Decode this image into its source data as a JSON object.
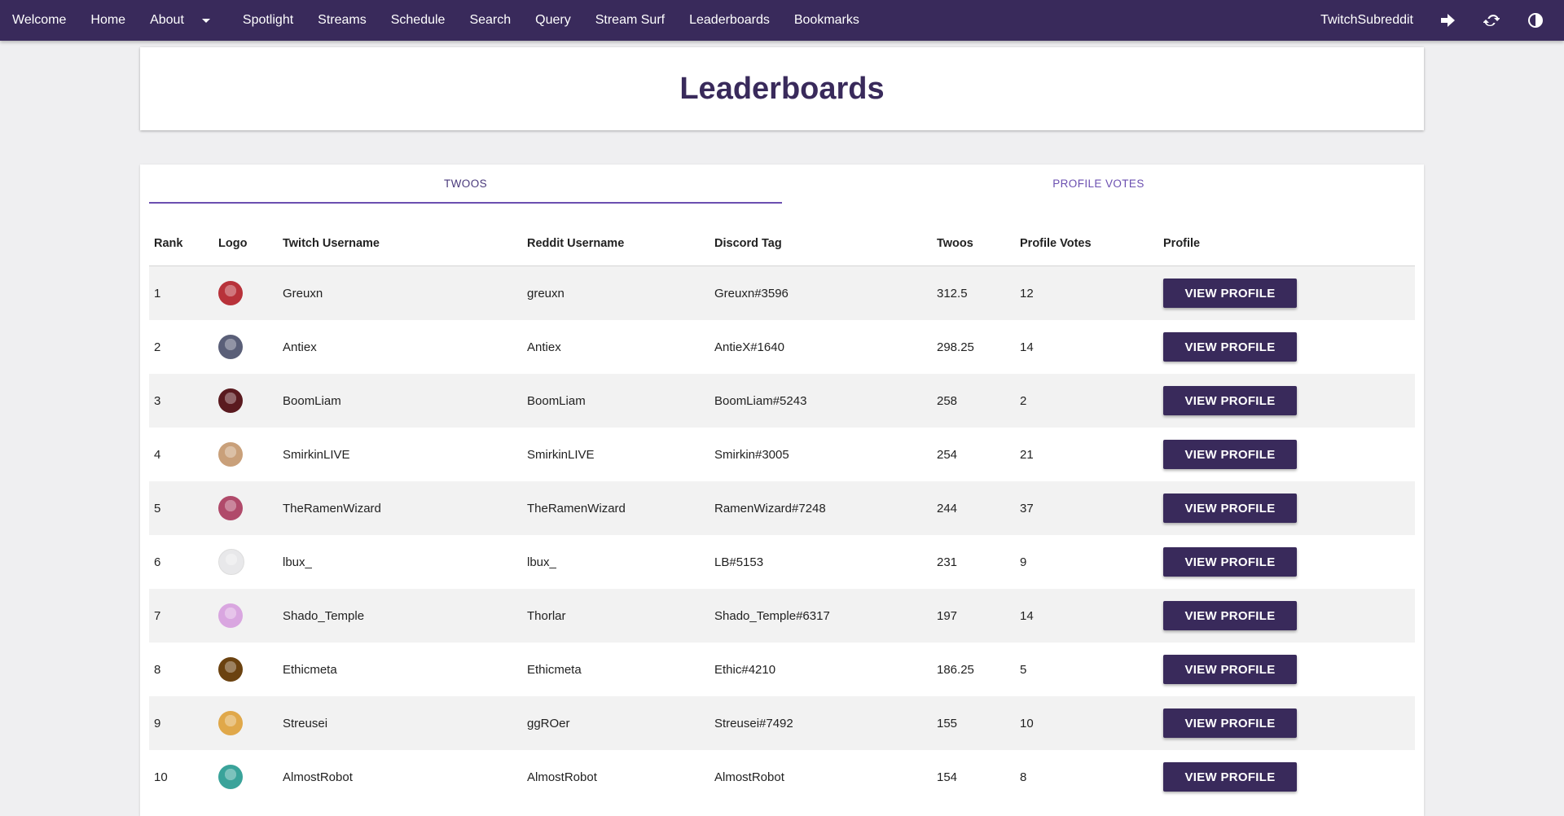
{
  "nav": {
    "items": [
      "Welcome",
      "Home",
      "About",
      "Spotlight",
      "Streams",
      "Schedule",
      "Search",
      "Query",
      "Stream Surf",
      "Leaderboards",
      "Bookmarks"
    ],
    "brand": "TwitchSubreddit",
    "icons": [
      "sign-in-icon",
      "refresh-icon",
      "contrast-icon"
    ]
  },
  "page": {
    "title": "Leaderboards"
  },
  "tabs": [
    {
      "label": "TWOOS",
      "active": true
    },
    {
      "label": "PROFILE VOTES",
      "active": false
    }
  ],
  "table": {
    "headers": [
      "Rank",
      "Logo",
      "Twitch Username",
      "Reddit Username",
      "Discord Tag",
      "Twoos",
      "Profile Votes",
      "Profile"
    ],
    "button_label": "VIEW PROFILE",
    "rows": [
      {
        "rank": "1",
        "logo_color": "#b8323a",
        "twitch": "Greuxn",
        "reddit": "greuxn",
        "discord": "Greuxn#3596",
        "twoos": "312.5",
        "votes": "12"
      },
      {
        "rank": "2",
        "logo_color": "#5a5f78",
        "twitch": "Antiex",
        "reddit": "Antiex",
        "discord": "AntieX#1640",
        "twoos": "298.25",
        "votes": "14"
      },
      {
        "rank": "3",
        "logo_color": "#5a1a1f",
        "twitch": "BoomLiam",
        "reddit": "BoomLiam",
        "discord": "BoomLiam#5243",
        "twoos": "258",
        "votes": "2"
      },
      {
        "rank": "4",
        "logo_color": "#c9a07a",
        "twitch": "SmirkinLIVE",
        "reddit": "SmirkinLIVE",
        "discord": "Smirkin#3005",
        "twoos": "254",
        "votes": "21"
      },
      {
        "rank": "5",
        "logo_color": "#b04a6a",
        "twitch": "TheRamenWizard",
        "reddit": "TheRamenWizard",
        "discord": "RamenWizard#7248",
        "twoos": "244",
        "votes": "37"
      },
      {
        "rank": "6",
        "logo_color": "#e8e8ea",
        "twitch": "lbux_",
        "reddit": "lbux_",
        "discord": "LB#5153",
        "twoos": "231",
        "votes": "9"
      },
      {
        "rank": "7",
        "logo_color": "#d9a6e0",
        "twitch": "Shado_Temple",
        "reddit": "Thorlar",
        "discord": "Shado_Temple#6317",
        "twoos": "197",
        "votes": "14"
      },
      {
        "rank": "8",
        "logo_color": "#6b4210",
        "twitch": "Ethicmeta",
        "reddit": "Ethicmeta",
        "discord": "Ethic#4210",
        "twoos": "186.25",
        "votes": "5"
      },
      {
        "rank": "9",
        "logo_color": "#e0a84a",
        "twitch": "Streusei",
        "reddit": "ggROer",
        "discord": "Streusei#7492",
        "twoos": "155",
        "votes": "10"
      },
      {
        "rank": "10",
        "logo_color": "#3aa39a",
        "twitch": "AlmostRobot",
        "reddit": "AlmostRobot",
        "discord": "AlmostRobot",
        "twoos": "154",
        "votes": "8"
      }
    ]
  },
  "colors": {
    "nav_bg": "#392a5b",
    "accent": "#6b4fb0",
    "title": "#392a5b"
  }
}
